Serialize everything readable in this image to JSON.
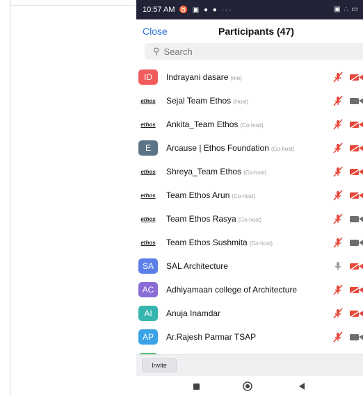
{
  "statusbar": {
    "time": "10:57 AM",
    "left_icons": "♉ ▣ ● ● ···",
    "right_icons": "▣ ∴ ▭"
  },
  "header": {
    "close_label": "Close",
    "title": "Participants (47)"
  },
  "search": {
    "placeholder": "Search"
  },
  "participants": [
    {
      "initials": "ID",
      "avatar_color": "#f25b5b",
      "name": "Indrayani dasare",
      "role": "(me)",
      "mic": "muted",
      "cam": "off"
    },
    {
      "initials": "ethos",
      "avatar_color": "logo",
      "name": "Sejal Team Ethos",
      "role": "(Host)",
      "mic": "muted",
      "cam": "on"
    },
    {
      "initials": "ethos",
      "avatar_color": "logo",
      "name": "Ankita_Team Ethos",
      "role": "(Co-host)",
      "mic": "muted",
      "cam": "off"
    },
    {
      "initials": "E",
      "avatar_color": "#5d7386",
      "name": "Arcause | Ethos Foundation",
      "role": "(Co-host)",
      "mic": "muted",
      "cam": "off"
    },
    {
      "initials": "ethos",
      "avatar_color": "logo",
      "name": "Shreya_Team Ethos",
      "role": "(Co-host)",
      "mic": "muted",
      "cam": "off"
    },
    {
      "initials": "ethos",
      "avatar_color": "logo",
      "name": "Team Ethos Arun",
      "role": "(Co-host)",
      "mic": "muted",
      "cam": "off"
    },
    {
      "initials": "ethos",
      "avatar_color": "logo",
      "name": "Team Ethos Rasya",
      "role": "(Co-host)",
      "mic": "muted",
      "cam": "on"
    },
    {
      "initials": "ethos",
      "avatar_color": "logo",
      "name": "Team Ethos Sushmita",
      "role": "(Co-host)",
      "mic": "muted",
      "cam": "on"
    },
    {
      "initials": "SA",
      "avatar_color": "#5b7ee8",
      "name": "SAL Architecture",
      "role": "",
      "mic": "on",
      "cam": "off"
    },
    {
      "initials": "AC",
      "avatar_color": "#8a6cd6",
      "name": "Adhiyamaan college of Architecture",
      "role": "",
      "mic": "muted",
      "cam": "off"
    },
    {
      "initials": "AI",
      "avatar_color": "#37b6b0",
      "name": "Anuja Inamdar",
      "role": "",
      "mic": "muted",
      "cam": "off"
    },
    {
      "initials": "AP",
      "avatar_color": "#3aa3e8",
      "name": "Ar.Rajesh Parmar TSAP",
      "role": "",
      "mic": "muted",
      "cam": "on"
    }
  ],
  "bottombar": {
    "invite_label": "Invite"
  },
  "colors": {
    "accent": "#2d6fd8",
    "muted_red": "#e8473a",
    "grey_icon": "#6e6e6e"
  }
}
